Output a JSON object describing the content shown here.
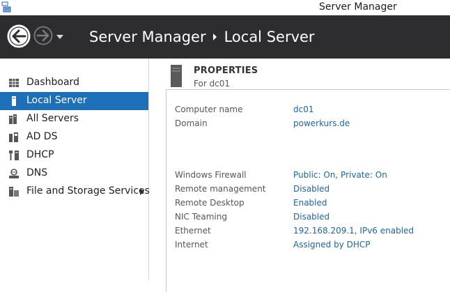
{
  "window": {
    "title": "Server Manager"
  },
  "header": {
    "breadcrumb_app": "Server Manager",
    "breadcrumb_page": "Local Server"
  },
  "sidebar": {
    "items": [
      {
        "label": "Dashboard",
        "icon": "dashboard-icon"
      },
      {
        "label": "Local Server",
        "icon": "server-icon",
        "active": true
      },
      {
        "label": "All Servers",
        "icon": "servers-icon"
      },
      {
        "label": "AD DS",
        "icon": "ad-ds-icon"
      },
      {
        "label": "DHCP",
        "icon": "dhcp-icon"
      },
      {
        "label": "DNS",
        "icon": "dns-icon"
      },
      {
        "label": "File and Storage Services",
        "icon": "storage-icon",
        "expandable": true
      }
    ]
  },
  "properties": {
    "title": "PROPERTIES",
    "subtitle": "For dc01",
    "group1": [
      {
        "label": "Computer name",
        "value": "dc01"
      },
      {
        "label": "Domain",
        "value": "powerkurs.de"
      }
    ],
    "group2": [
      {
        "label": "Windows Firewall",
        "value": "Public: On, Private: On"
      },
      {
        "label": "Remote management",
        "value": "Disabled"
      },
      {
        "label": "Remote Desktop",
        "value": "Enabled"
      },
      {
        "label": "NIC Teaming",
        "value": "Disabled"
      },
      {
        "label": "Ethernet",
        "value": "192.168.209.1, IPv6 enabled"
      },
      {
        "label": "Internet",
        "value": "Assigned by DHCP"
      }
    ]
  },
  "colors": {
    "header_bg": "#2d2d30",
    "accent_selected": "#1d6fb8",
    "link": "#1d64a8"
  }
}
